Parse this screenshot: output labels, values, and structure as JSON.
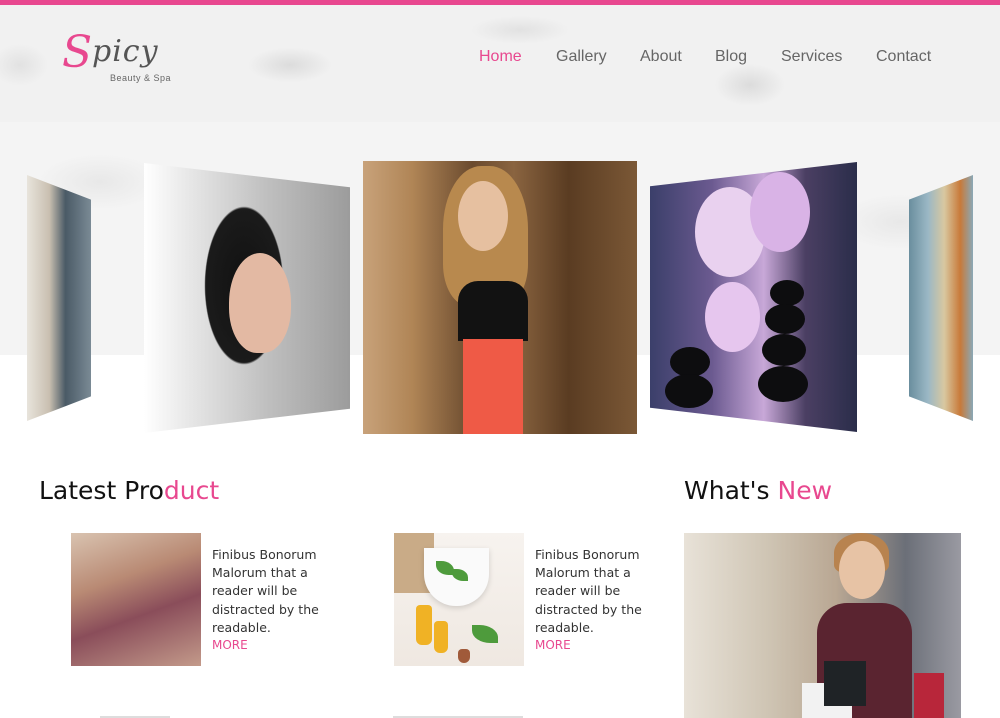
{
  "brand": {
    "logo_initial": "S",
    "logo_rest": "picy",
    "tagline": "Beauty & Spa",
    "accent_color": "#e8488f"
  },
  "nav": {
    "items": [
      {
        "label": "Home",
        "active": true
      },
      {
        "label": "Gallery",
        "active": false
      },
      {
        "label": "About",
        "active": false
      },
      {
        "label": "Blog",
        "active": false
      },
      {
        "label": "Services",
        "active": false
      },
      {
        "label": "Contact",
        "active": false
      }
    ]
  },
  "latest_product": {
    "title_plain": "Latest Pro",
    "title_accent": "duct",
    "products": [
      {
        "text": "Finibus Bonorum Malorum that a reader will be distracted by the readable.",
        "more_label": "MORE"
      },
      {
        "text": "Finibus Bonorum Malorum that a reader will be distracted by the readable.",
        "more_label": "MORE"
      }
    ]
  },
  "whats_new": {
    "title_plain": "What's ",
    "title_accent": "New"
  }
}
